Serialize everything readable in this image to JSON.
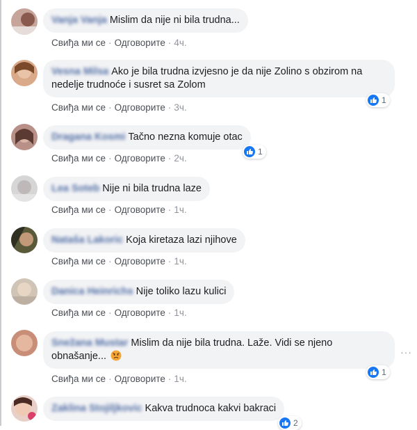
{
  "actions": {
    "like_label": "Свиђа ми се",
    "reply_label": "Одговорите",
    "separator": "·"
  },
  "comments": [
    {
      "author": "Vanja Vanja",
      "text": "Mislim da nije ni bila trudna...",
      "time": "4ч.",
      "reactions": null
    },
    {
      "author": "Vesna Milsa",
      "text": "Ako je bila trudna izvjesno je da nije Zolino s obzirom na nedelje trudnoće i susret sa Zolom",
      "time": "3ч.",
      "reactions": "1"
    },
    {
      "author": "Dragana Kosmi",
      "text": "Tačno nezna komuje otac",
      "time": "2ч.",
      "reactions": "1"
    },
    {
      "author": "Lea Soteb",
      "text": "Nije ni bila trudna laze",
      "time": "1ч.",
      "reactions": null
    },
    {
      "author": "Nataša Lakoric",
      "text": "Koja kiretaza lazi njihove",
      "time": "1ч.",
      "reactions": null
    },
    {
      "author": "Danica Heinrichs",
      "text": "Nije toliko lazu kulici",
      "time": "1ч.",
      "reactions": null
    },
    {
      "author": "Snežana Mustar",
      "text": "Mislim da nije bila trudna. Laže. Vidi se njeno obnašanje...",
      "time": "1ч.",
      "reactions": "1"
    },
    {
      "author": "Zaklina Stojiljkovic",
      "text": "Kakva trudnoca kakvi bakraci",
      "time": "",
      "reactions": "2"
    }
  ],
  "colors": {
    "bubble_bg": "#f2f3f5",
    "link": "#385898",
    "like_blue": "#1877f2",
    "meta_gray": "#90949c"
  },
  "icons": {
    "reaction": "like-thumb-icon",
    "emoji": "angry-face-icon",
    "more": "more-options-icon"
  }
}
